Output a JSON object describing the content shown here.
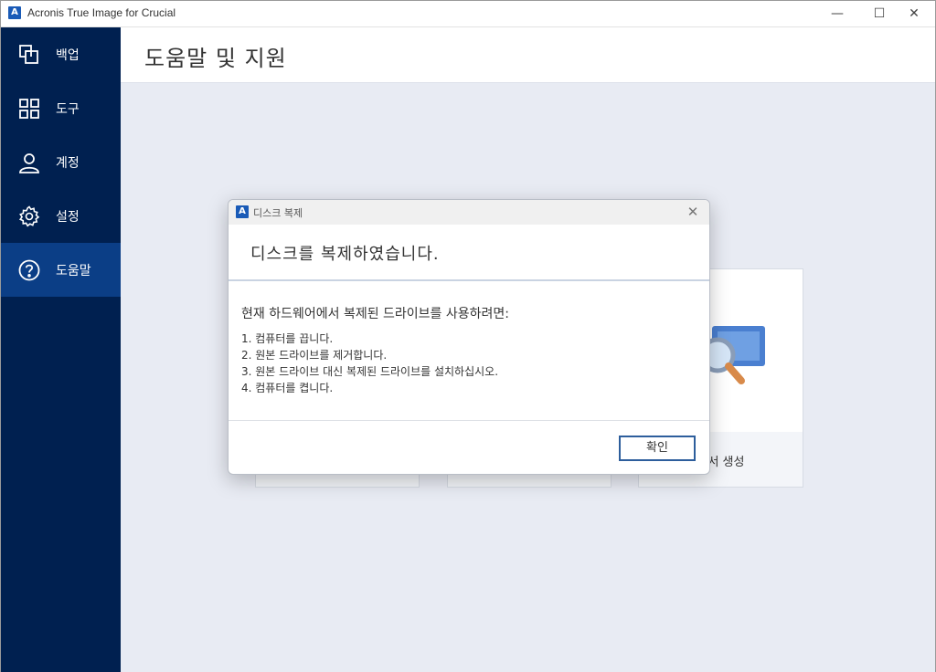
{
  "window": {
    "title": "Acronis True Image for Crucial",
    "app_logo": "A",
    "min_glyph": "—",
    "max_glyph": "☐",
    "close_glyph": "✕"
  },
  "sidebar": {
    "items": [
      {
        "label": "백업",
        "icon": "backup-icon"
      },
      {
        "label": "도구",
        "icon": "tools-icon"
      },
      {
        "label": "계정",
        "icon": "account-icon"
      },
      {
        "label": "설정",
        "icon": "gear-icon"
      },
      {
        "label": "도움말",
        "icon": "help-icon",
        "active": true
      }
    ]
  },
  "main": {
    "title": "도움말 및 지원",
    "cards": [
      {
        "label": ""
      },
      {
        "label": ""
      },
      {
        "label": "고서 생성",
        "icon": "magnifier-icon"
      }
    ]
  },
  "dialog": {
    "logo": "A",
    "title": "디스크 복제",
    "close_glyph": "✕",
    "heading": "디스크를 복제하였습니다.",
    "intro": "현재 하드웨어에서 복제된 드라이브를 사용하려면:",
    "steps": [
      "1. 컴퓨터를 끕니다.",
      "2. 원본 드라이브를 제거합니다.",
      "3. 원본 드라이브 대신 복제된 드라이브를 설치하십시오.",
      "4. 컴퓨터를 켭니다."
    ],
    "ok_label": "확인"
  },
  "colors": {
    "sidebar_bg": "#002050",
    "sidebar_active": "#0b3e86",
    "main_bg": "#e8ebf3",
    "accent": "#1a5bb7",
    "ok_border": "#2d5e9c"
  }
}
